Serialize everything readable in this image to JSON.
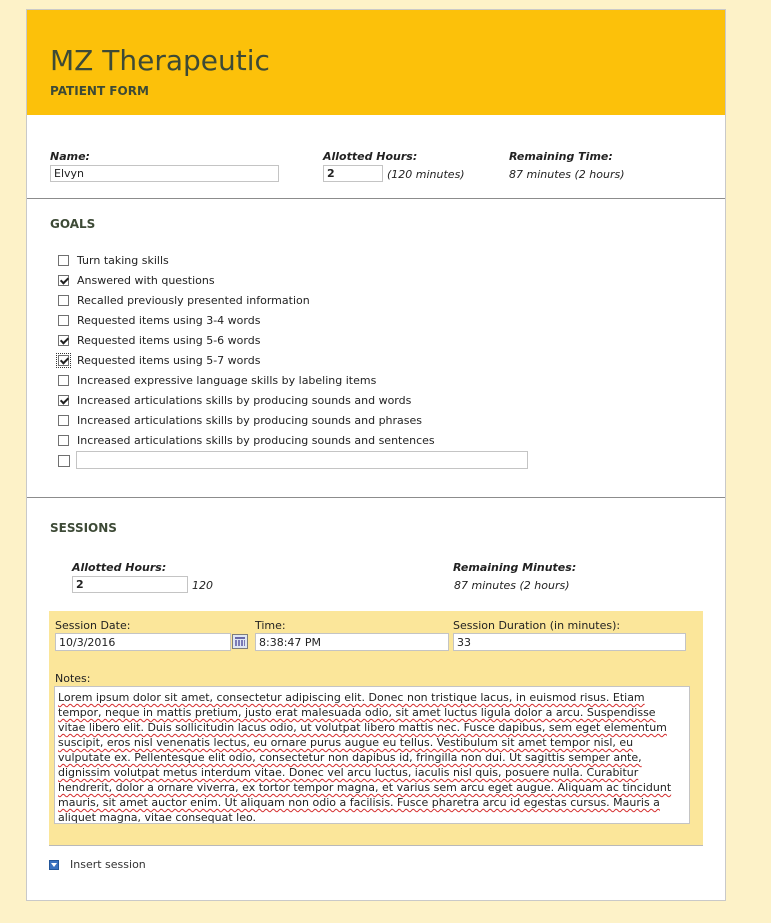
{
  "form": {
    "title": "MZ Therapeutic",
    "subtitle": "PATIENT FORM"
  },
  "patient": {
    "name_label": "Name:",
    "name_value": "Elvyn",
    "allotted_label": "Allotted Hours:",
    "allotted_value": "2",
    "allotted_minutes": "(120 minutes)",
    "remaining_label": "Remaining Time:",
    "remaining_value": "87 minutes (2 hours)"
  },
  "goals": {
    "title": "GOALS",
    "items": [
      {
        "label": "Turn taking skills",
        "checked": false
      },
      {
        "label": "Answered with questions",
        "checked": true
      },
      {
        "label": "Recalled previously presented information",
        "checked": false
      },
      {
        "label": "Requested items using 3-4 words",
        "checked": false
      },
      {
        "label": "Requested items using 5-6 words",
        "checked": true
      },
      {
        "label": "Requested items using 5-7 words",
        "checked": true,
        "focused": true
      },
      {
        "label": "Increased expressive language skills by labeling items",
        "checked": false
      },
      {
        "label": "Increased articulations skills by producing sounds and words",
        "checked": true
      },
      {
        "label": "Increased articulations skills by producing sounds and phrases",
        "checked": false
      },
      {
        "label": "Increased articulations skills by producing sounds and sentences",
        "checked": false
      }
    ],
    "other_value": ""
  },
  "sessions": {
    "title": "SESSIONS",
    "allotted_label": "Allotted Hours:",
    "allotted_value": "2",
    "allotted_minutes": "120",
    "remaining_label": "Remaining Minutes:",
    "remaining_value": "87 minutes (2 hours)",
    "entry": {
      "date_label": "Session Date:",
      "date_value": "10/3/2016",
      "time_label": "Time:",
      "time_value": "8:38:47 PM",
      "duration_label": "Session Duration (in minutes):",
      "duration_value": "33",
      "notes_label": "Notes:",
      "notes_value": "Lorem ipsum dolor sit amet, consectetur adipiscing elit. Donec non tristique lacus, in euismod risus. Etiam tempor, neque in mattis pretium, justo erat malesuada odio, sit amet luctus ligula dolor a arcu. Suspendisse vitae libero elit. Duis sollicitudin lacus odio, ut volutpat libero mattis nec. Fusce dapibus, sem eget elementum suscipit, eros nisl venenatis lectus, eu ornare purus augue eu tellus. Vestibulum sit amet tempor nisl, eu vulputate ex. Pellentesque elit odio, consectetur non dapibus id, fringilla non dui. Ut sagittis semper ante, dignissim volutpat metus interdum vitae. Donec vel arcu luctus, iaculis nisl quis, posuere nulla. Curabitur hendrerit, dolor a ornare viverra, ex tortor tempor magna, et varius sem arcu eget augue. Aliquam ac tincidunt mauris, sit amet auctor enim. Ut aliquam non odio a facilisis. Fusce pharetra arcu id egestas cursus. Mauris a aliquet magna, vitae consequat leo."
    },
    "insert_label": "Insert session"
  }
}
